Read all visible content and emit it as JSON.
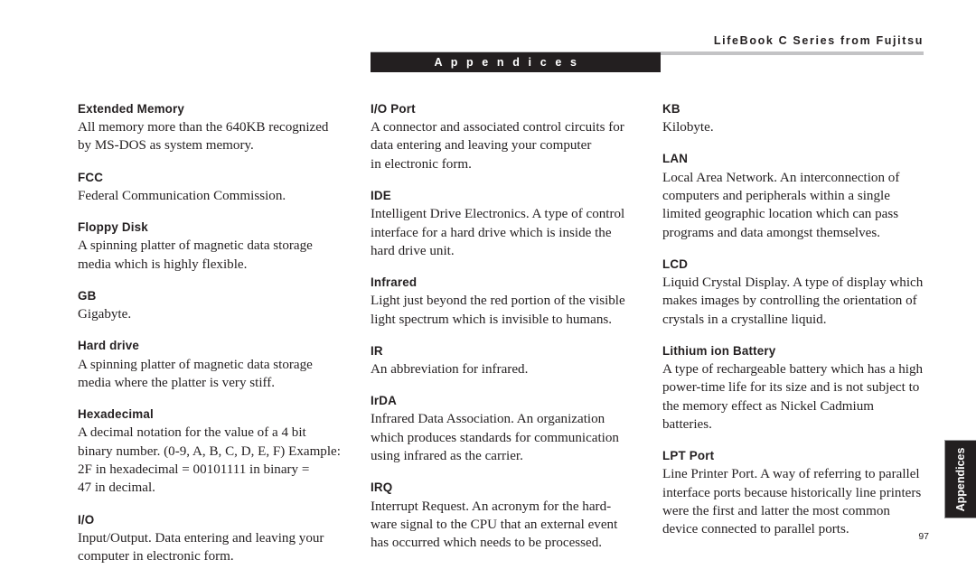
{
  "header": {
    "book_title": "LifeBook C Series from Fujitsu",
    "section_label": "A p p e n d i c e s"
  },
  "side_tab": {
    "label": "Appendices"
  },
  "footer": {
    "page_number": "97"
  },
  "colors": {
    "ink": "#231f20",
    "rule_gray": "#c3c3c5",
    "tab_black": "#231f20",
    "paper": "#ffffff"
  },
  "glossary": {
    "columns": [
      {
        "name": "left",
        "entries": [
          {
            "term": "Extended Memory",
            "definition": "All memory more than the 640KB recognized\nby MS-DOS as system memory."
          },
          {
            "term": "FCC",
            "definition": "Federal Communication Commission."
          },
          {
            "term": "Floppy Disk",
            "definition": "A spinning platter of magnetic data storage\nmedia which is highly flexible."
          },
          {
            "term": "GB",
            "definition": "Gigabyte."
          },
          {
            "term": "Hard drive",
            "definition": "A spinning platter of magnetic data storage\nmedia where the platter is very stiff."
          },
          {
            "term": "Hexadecimal",
            "definition": "A decimal notation for the value of a 4 bit\nbinary number. (0-9, A, B, C, D, E, F) Example:\n2F in hexadecimal = 00101111 in binary =\n47 in decimal."
          },
          {
            "term": "I/O",
            "definition": "Input/Output. Data entering and leaving your\ncomputer in electronic form."
          }
        ]
      },
      {
        "name": "middle",
        "entries": [
          {
            "term": "I/O Port",
            "definition": "A connector and associated control circuits for\ndata entering and leaving your computer\nin electronic form."
          },
          {
            "term": "IDE",
            "definition": "Intelligent Drive Electronics. A type of control\ninterface for a hard drive which is inside the\nhard drive unit."
          },
          {
            "term": "Infrared",
            "definition": "Light just beyond the red portion of the visible\nlight spectrum which is invisible to humans."
          },
          {
            "term": "IR",
            "definition": "An abbreviation for infrared."
          },
          {
            "term": "IrDA",
            "definition": "Infrared Data Association. An organization\nwhich produces standards for communication\nusing infrared as the carrier."
          },
          {
            "term": "IRQ",
            "definition": "Interrupt Request. An acronym for the hard-\nware signal to the CPU that an external event\nhas occurred which needs to be processed."
          }
        ]
      },
      {
        "name": "right",
        "entries": [
          {
            "term": "KB",
            "definition": "Kilobyte."
          },
          {
            "term": "LAN",
            "definition": "Local Area Network. An interconnection of\ncomputers and peripherals within a single\nlimited geographic location which can pass\nprograms and data amongst themselves."
          },
          {
            "term": "LCD",
            "definition": "Liquid Crystal Display. A type of display which\nmakes images by controlling the orientation of\ncrystals in a crystalline liquid."
          },
          {
            "term": "Lithium ion Battery",
            "definition": "A type of rechargeable battery which has a high\npower-time life for its size and is not subject to\nthe memory effect as Nickel Cadmium batteries."
          },
          {
            "term": "LPT Port",
            "definition": "Line Printer Port. A way of referring to parallel\ninterface ports because historically line printers\nwere the first and latter the most common\ndevice connected to parallel ports."
          }
        ]
      }
    ]
  }
}
